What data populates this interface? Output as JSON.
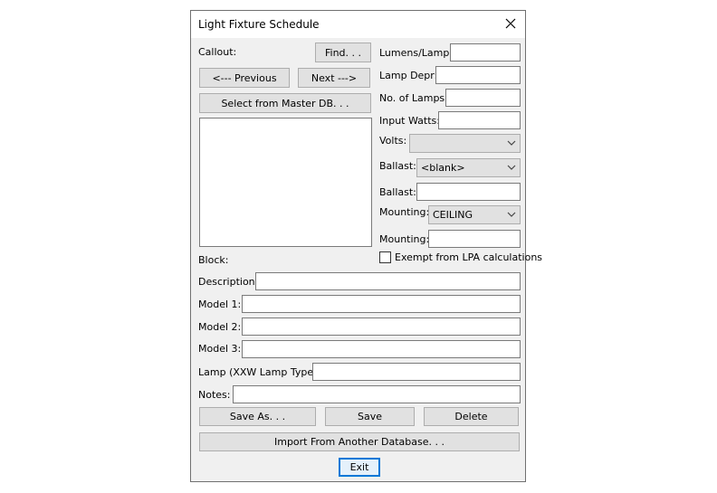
{
  "window": {
    "title": "Light Fixture Schedule"
  },
  "labels": {
    "callout": "Callout:",
    "block": "Block:",
    "description": "Description:",
    "model1": "Model 1:",
    "model2": "Model 2:",
    "model3": "Model 3:",
    "lamp_type": "Lamp (XXW Lamp Type):",
    "notes": "Notes:",
    "lumens_lamp": "Lumens/Lamp:",
    "lamp_depr": "Lamp Depr:",
    "no_of_lamps": "No. of Lamps:",
    "input_watts": "Input Watts:",
    "volts": "Volts:",
    "ballast_combo": "Ballast:",
    "ballast_text": "Ballast:",
    "mounting_combo": "Mounting:",
    "mounting_text": "Mounting:",
    "exempt": "Exempt from LPA calculations"
  },
  "buttons": {
    "find": "Find. . .",
    "previous": "<--- Previous",
    "next": "Next --->",
    "select_master": "Select from Master DB. . .",
    "save_as": "Save As. . .",
    "save": "Save",
    "delete": "Delete",
    "import": "Import From Another Database. . .",
    "exit": "Exit"
  },
  "combos": {
    "volts": "",
    "ballast": "<blank>",
    "mounting": "CEILING"
  },
  "checkbox": {
    "exempt_checked": false
  },
  "icons": {
    "close": "close-icon",
    "dropdown": "chevron-down-icon"
  }
}
